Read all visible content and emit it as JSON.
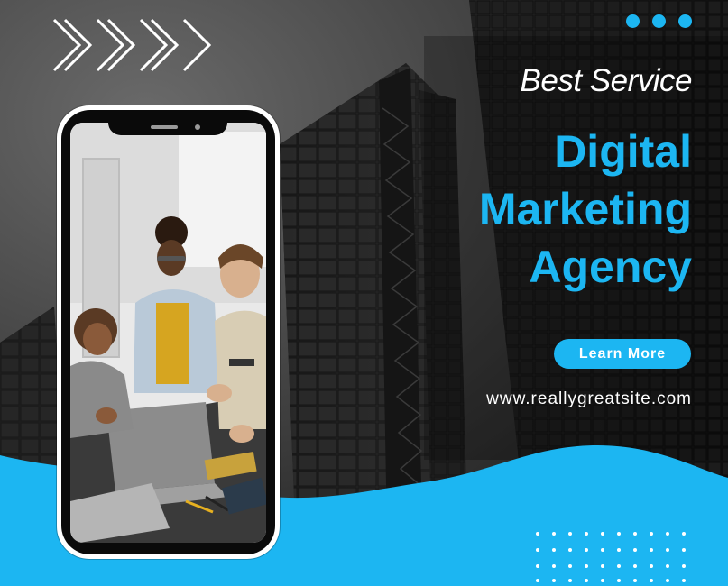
{
  "header": {
    "eyebrow": "Best Service",
    "headline_lines": [
      "Digital",
      "Marketing",
      "Agency"
    ]
  },
  "cta": {
    "learn_more_label": "Learn More"
  },
  "footer": {
    "website": "www.reallygreatsite.com"
  },
  "colors": {
    "accent": "#1cb6f2",
    "text_light": "#ffffff",
    "background_dark": "#2b2b2b"
  },
  "icons": {
    "chevrons": "double-chevron-right-icon",
    "dots": "three-dots-icon",
    "dot_grid": "dot-grid-pattern"
  },
  "images": {
    "background": "skyscrapers looking up, grayscale",
    "phone_screen": "team of three people collaborating around a laptop"
  }
}
